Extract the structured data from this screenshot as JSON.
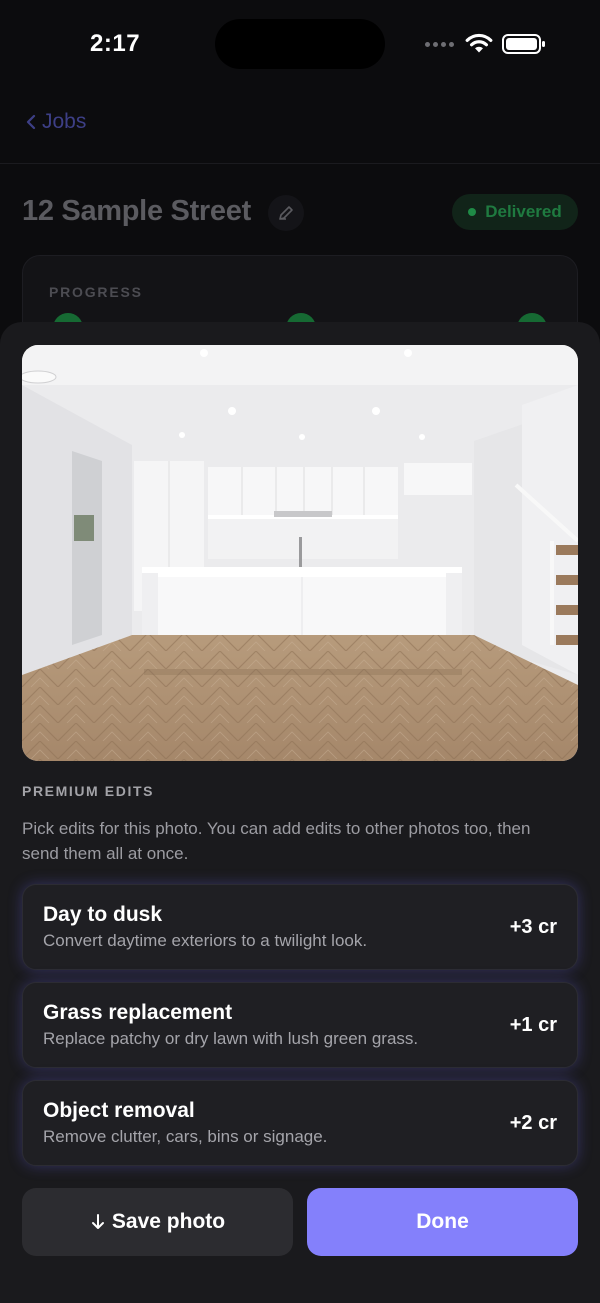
{
  "status_bar": {
    "time": "2:17"
  },
  "nav": {
    "back_label": "Jobs"
  },
  "job": {
    "title": "12 Sample Street",
    "status": "Delivered",
    "progress_label": "PROGRESS"
  },
  "sheet": {
    "section_label": "PREMIUM EDITS",
    "description": "Pick edits for this photo. You can add edits to other photos too, then send them all at once.",
    "options": [
      {
        "title": "Day to dusk",
        "description": "Convert daytime exteriors to a twilight look.",
        "price": "+3 cr"
      },
      {
        "title": "Grass replacement",
        "description": "Replace patchy or dry lawn with lush green grass.",
        "price": "+1 cr"
      },
      {
        "title": "Object removal",
        "description": "Remove clutter, cars, bins or signage.",
        "price": "+2 cr"
      }
    ],
    "save_label": "Save photo",
    "done_label": "Done"
  },
  "colors": {
    "accent": "#8480fb",
    "status_green": "#1f8a46",
    "sheet_bg": "#1a1a1d"
  },
  "icons": [
    "wifi-icon",
    "battery-icon",
    "chevron-left-icon",
    "pencil-icon",
    "download-arrow-icon"
  ]
}
